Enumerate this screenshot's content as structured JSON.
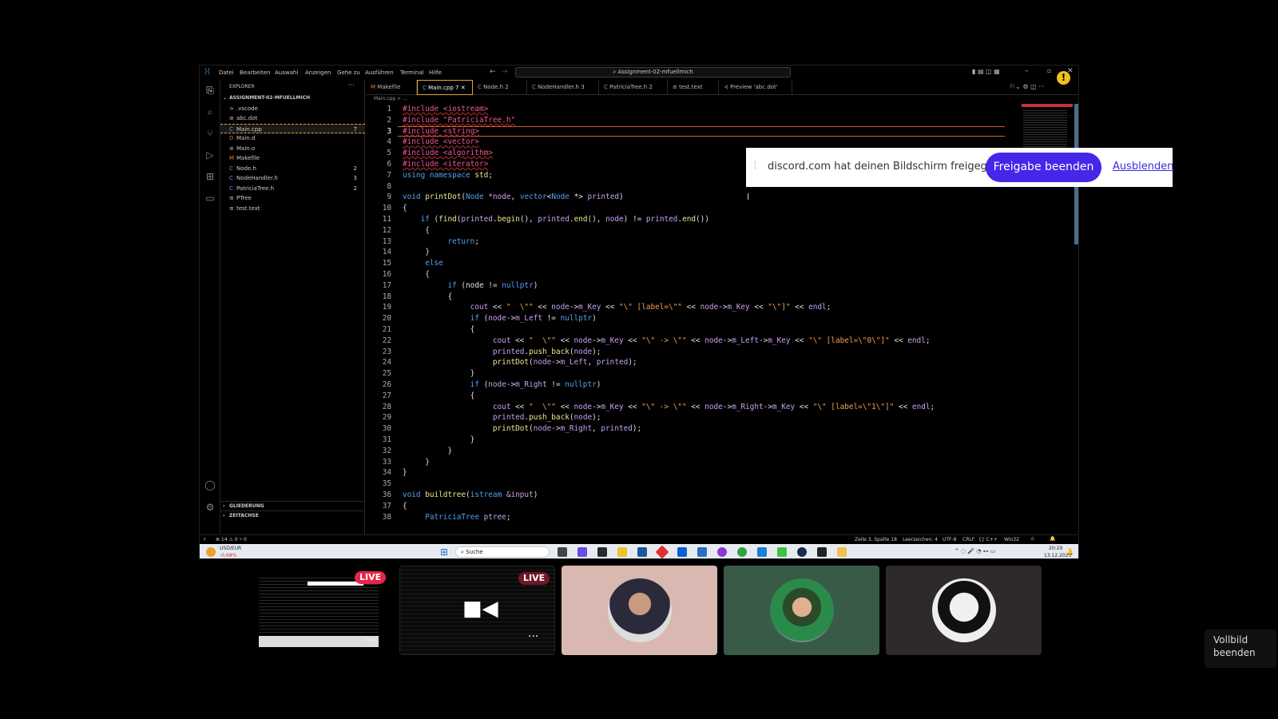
{
  "titlebar": {
    "menus": [
      "Datei",
      "Bearbeiten",
      "Auswahl",
      "Anzeigen",
      "Gehe zu",
      "Ausführen",
      "Terminal",
      "Hilfe"
    ],
    "search": "Assignment-02-mfuellmich"
  },
  "sidebar": {
    "title": "EXPLORER",
    "root": "ASSIGNMENT-02-MFUELLMICH",
    "files": [
      {
        "name": ".vscode",
        "icon": ">",
        "count": ""
      },
      {
        "name": "abc.dot",
        "icon": "≡",
        "count": ""
      },
      {
        "name": "Main.cpp",
        "icon": "C",
        "count": "7"
      },
      {
        "name": "Main.d",
        "icon": "D",
        "count": ""
      },
      {
        "name": "Main.o",
        "icon": "≡",
        "count": ""
      },
      {
        "name": "Makefile",
        "icon": "M",
        "count": ""
      },
      {
        "name": "Node.h",
        "icon": "C",
        "count": "2"
      },
      {
        "name": "NodeHandler.h",
        "icon": "C",
        "count": "3"
      },
      {
        "name": "PatriciaTree.h",
        "icon": "C",
        "count": "2"
      },
      {
        "name": "PTree",
        "icon": "≡",
        "count": ""
      },
      {
        "name": "test.text",
        "icon": "≡",
        "count": ""
      }
    ],
    "outline": "GLIEDERUNG",
    "timeline": "ZEITACHSE"
  },
  "tabs": [
    {
      "label": "Makefile",
      "icon": "M"
    },
    {
      "label": "Main.cpp 7",
      "icon": "C"
    },
    {
      "label": "Node.h 2",
      "icon": "C"
    },
    {
      "label": "NodeHandler.h 3",
      "icon": "C"
    },
    {
      "label": "PatriciaTree.h 2",
      "icon": "C"
    },
    {
      "label": "test.text",
      "icon": "≡"
    },
    {
      "label": "Preview 'abc.dot'",
      "icon": "⊰"
    }
  ],
  "breadcrumb": "Main.cpp > ...",
  "code": [
    [
      [
        "inc",
        "#include <iostream>"
      ]
    ],
    [
      [
        "inc",
        "#include \"PatriciaTree.h\""
      ]
    ],
    [
      [
        "inc",
        "#include <string>"
      ]
    ],
    [
      [
        "inc",
        "#include <vector>"
      ]
    ],
    [
      [
        "inc",
        "#include <algorithm>"
      ]
    ],
    [
      [
        "inc",
        "#include <iterator>"
      ]
    ],
    [
      [
        "kw",
        "using namespace "
      ],
      [
        "fn",
        "std"
      ],
      [
        "",
        "; "
      ]
    ],
    [
      [
        "",
        ""
      ]
    ],
    [
      [
        "kw",
        "void "
      ],
      [
        "fn",
        "printDot"
      ],
      [
        "",
        "("
      ],
      [
        "kw",
        "Node "
      ],
      [
        "var",
        "*node"
      ],
      [
        "",
        ", "
      ],
      [
        "kw",
        "vector"
      ],
      [
        "",
        "<"
      ],
      [
        "kw",
        "Node"
      ],
      [
        "",
        " *> "
      ],
      [
        "var",
        "printed"
      ],
      [
        "",
        ")"
      ]
    ],
    [
      [
        "",
        "{"
      ]
    ],
    [
      [
        "",
        "    "
      ],
      [
        "kw",
        "if "
      ],
      [
        "",
        "("
      ],
      [
        "fn",
        "find"
      ],
      [
        "",
        "("
      ],
      [
        "var",
        "printed"
      ],
      [
        "",
        "."
      ],
      [
        "fn",
        "begin"
      ],
      [
        "",
        "(), "
      ],
      [
        "var",
        "printed"
      ],
      [
        "",
        "."
      ],
      [
        "fn",
        "end"
      ],
      [
        "",
        "(), "
      ],
      [
        "var",
        "node"
      ],
      [
        "",
        ") != "
      ],
      [
        "var",
        "printed"
      ],
      [
        "",
        "."
      ],
      [
        "fn",
        "end"
      ],
      [
        "",
        "())"
      ]
    ],
    [
      [
        "",
        "     {"
      ]
    ],
    [
      [
        "",
        "          "
      ],
      [
        "kw",
        "return"
      ],
      [
        "",
        ";"
      ]
    ],
    [
      [
        "",
        "     }"
      ]
    ],
    [
      [
        "",
        "     "
      ],
      [
        "kw",
        "else"
      ]
    ],
    [
      [
        "",
        "     {"
      ]
    ],
    [
      [
        "",
        "          "
      ],
      [
        "kw",
        "if "
      ],
      [
        "",
        "(node != "
      ],
      [
        "kw",
        "nullptr"
      ],
      [
        "",
        ")"
      ]
    ],
    [
      [
        "",
        "          {"
      ]
    ],
    [
      [
        "",
        "               "
      ],
      [
        "var",
        "cout"
      ],
      [
        "",
        " << "
      ],
      [
        "str",
        "\"  \\\"\""
      ],
      [
        "",
        " << "
      ],
      [
        "var",
        "node"
      ],
      [
        "",
        "->"
      ],
      [
        "var",
        "m_Key"
      ],
      [
        "",
        " << "
      ],
      [
        "str",
        "\"\\\" [label=\\\"\""
      ],
      [
        "",
        " << "
      ],
      [
        "var",
        "node"
      ],
      [
        "",
        "->"
      ],
      [
        "var",
        "m_Key"
      ],
      [
        "",
        " << "
      ],
      [
        "str",
        "\"\\\"]\""
      ],
      [
        "",
        " << "
      ],
      [
        "var",
        "endl"
      ],
      [
        "",
        ";"
      ]
    ],
    [
      [
        "",
        "               "
      ],
      [
        "kw",
        "if "
      ],
      [
        "",
        "("
      ],
      [
        "var",
        "node"
      ],
      [
        "",
        "->"
      ],
      [
        "var",
        "m_Left"
      ],
      [
        "",
        " != "
      ],
      [
        "kw",
        "nullptr"
      ],
      [
        "",
        ")"
      ]
    ],
    [
      [
        "",
        "               {"
      ]
    ],
    [
      [
        "",
        "                    "
      ],
      [
        "var",
        "cout"
      ],
      [
        "",
        " << "
      ],
      [
        "str",
        "\"  \\\"\""
      ],
      [
        "",
        " << "
      ],
      [
        "var",
        "node"
      ],
      [
        "",
        "->"
      ],
      [
        "var",
        "m_Key"
      ],
      [
        "",
        " << "
      ],
      [
        "str",
        "\"\\\" -> \\\"\""
      ],
      [
        "",
        " << "
      ],
      [
        "var",
        "node"
      ],
      [
        "",
        "->"
      ],
      [
        "var",
        "m_Left"
      ],
      [
        "",
        "->"
      ],
      [
        "var",
        "m_Key"
      ],
      [
        "",
        " << "
      ],
      [
        "str",
        "\"\\\" [label=\\\"0\\\"]\""
      ],
      [
        "",
        " << "
      ],
      [
        "var",
        "endl"
      ],
      [
        "",
        ";"
      ]
    ],
    [
      [
        "",
        "                    "
      ],
      [
        "var",
        "printed"
      ],
      [
        "",
        "."
      ],
      [
        "fn",
        "push_back"
      ],
      [
        "",
        "("
      ],
      [
        "var",
        "node"
      ],
      [
        "",
        ");"
      ]
    ],
    [
      [
        "",
        "                    "
      ],
      [
        "fn",
        "printDot"
      ],
      [
        "",
        "("
      ],
      [
        "var",
        "node"
      ],
      [
        "",
        "->"
      ],
      [
        "var",
        "m_Left"
      ],
      [
        "",
        ", "
      ],
      [
        "var",
        "printed"
      ],
      [
        "",
        ");"
      ]
    ],
    [
      [
        "",
        "               }"
      ]
    ],
    [
      [
        "",
        "               "
      ],
      [
        "kw",
        "if "
      ],
      [
        "",
        "("
      ],
      [
        "var",
        "node"
      ],
      [
        "",
        "->"
      ],
      [
        "var",
        "m_Right"
      ],
      [
        "",
        " != "
      ],
      [
        "kw",
        "nullptr"
      ],
      [
        "",
        ")"
      ]
    ],
    [
      [
        "",
        "               {"
      ]
    ],
    [
      [
        "",
        "                    "
      ],
      [
        "var",
        "cout"
      ],
      [
        "",
        " << "
      ],
      [
        "str",
        "\"  \\\"\""
      ],
      [
        "",
        " << "
      ],
      [
        "var",
        "node"
      ],
      [
        "",
        "->"
      ],
      [
        "var",
        "m_Key"
      ],
      [
        "",
        " << "
      ],
      [
        "str",
        "\"\\\" -> \\\"\""
      ],
      [
        "",
        " << "
      ],
      [
        "var",
        "node"
      ],
      [
        "",
        "->"
      ],
      [
        "var",
        "m_Right"
      ],
      [
        "",
        "->"
      ],
      [
        "var",
        "m_Key"
      ],
      [
        "",
        " << "
      ],
      [
        "str",
        "\"\\\" [label=\\\"1\\\"]\""
      ],
      [
        "",
        " << "
      ],
      [
        "var",
        "endl"
      ],
      [
        "",
        ";"
      ]
    ],
    [
      [
        "",
        "                    "
      ],
      [
        "var",
        "printed"
      ],
      [
        "",
        "."
      ],
      [
        "fn",
        "push_back"
      ],
      [
        "",
        "("
      ],
      [
        "var",
        "node"
      ],
      [
        "",
        ");"
      ]
    ],
    [
      [
        "",
        "                    "
      ],
      [
        "fn",
        "printDot"
      ],
      [
        "",
        "("
      ],
      [
        "var",
        "node"
      ],
      [
        "",
        "->"
      ],
      [
        "var",
        "m_Right"
      ],
      [
        "",
        ", "
      ],
      [
        "var",
        "printed"
      ],
      [
        "",
        ");"
      ]
    ],
    [
      [
        "",
        "               }"
      ]
    ],
    [
      [
        "",
        "          }"
      ]
    ],
    [
      [
        "",
        "     }"
      ]
    ],
    [
      [
        "",
        "}"
      ]
    ],
    [
      [
        "",
        ""
      ]
    ],
    [
      [
        "kw",
        "void "
      ],
      [
        "fn",
        "buildtree"
      ],
      [
        "",
        "("
      ],
      [
        "kw",
        "istream "
      ],
      [
        "var",
        "&input"
      ],
      [
        "",
        ")"
      ]
    ],
    [
      [
        "",
        "{"
      ]
    ],
    [
      [
        "",
        "     "
      ],
      [
        "kw",
        "PatriciaTree "
      ],
      [
        "var",
        "ptree"
      ],
      [
        "",
        ";"
      ]
    ]
  ],
  "statusbar": {
    "left": "⊗ 14 ⚠ 0   ⑂ 0",
    "position": "Zeile 3, Spalte 18",
    "spaces": "Leerzeichen: 4",
    "encoding": "UTF-8",
    "eol": "CRLF",
    "language": "{} C++",
    "platform": "Win32"
  },
  "taskbar": {
    "ticker": "USD/EUR",
    "ticker_change": "-0,68%",
    "search": "Suche",
    "time": "20:29",
    "date": "13.12.2023"
  },
  "share": {
    "message": "discord.com hat deinen Bildschirm freigegeben.",
    "stop_label": "Freigabe beenden",
    "hide_label": "Ausblenden"
  },
  "thumbnails": {
    "live1": "LIVE",
    "live2": "LIVE"
  },
  "tooltip": "Vollbild beenden"
}
